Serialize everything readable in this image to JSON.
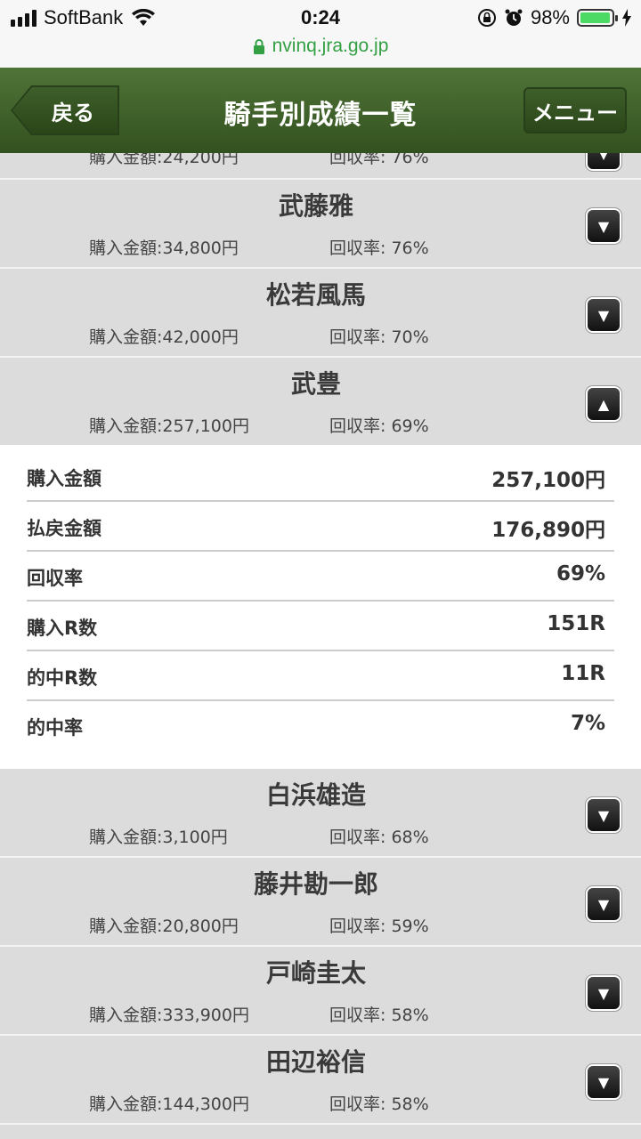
{
  "status_bar": {
    "carrier": "SoftBank",
    "time": "0:24",
    "battery": "98%",
    "battery_level": 0.98
  },
  "url_bar": {
    "url": "nvinq.jra.go.jp"
  },
  "header": {
    "back_label": "戻る",
    "title": "騎手別成績一覧",
    "menu_label": "メニュー"
  },
  "rows_before": [
    {
      "name": "",
      "buy": "購入金額:24,200円",
      "rate": "回収率: 76%",
      "partial": true
    },
    {
      "name": "武藤雅",
      "buy": "購入金額:34,800円",
      "rate": "回収率: 76%"
    },
    {
      "name": "松若風馬",
      "buy": "購入金額:42,000円",
      "rate": "回収率: 70%"
    }
  ],
  "expanded_row": {
    "name": "武豊",
    "buy": "購入金額:257,100円",
    "rate": "回収率: 69%",
    "details": [
      {
        "label": "購入金額",
        "value": "257,100円"
      },
      {
        "label": "払戻金額",
        "value": "176,890円"
      },
      {
        "label": "回収率",
        "value": "69%"
      },
      {
        "label": "購入R数",
        "value": "151R"
      },
      {
        "label": "的中R数",
        "value": "11R"
      },
      {
        "label": "的中率",
        "value": "7%"
      }
    ]
  },
  "rows_after": [
    {
      "name": "白浜雄造",
      "buy": "購入金額:3,100円",
      "rate": "回収率: 68%"
    },
    {
      "name": "藤井勘一郎",
      "buy": "購入金額:20,800円",
      "rate": "回収率: 59%"
    },
    {
      "name": "戸崎圭太",
      "buy": "購入金額:333,900円",
      "rate": "回収率: 58%"
    },
    {
      "name": "田辺裕信",
      "buy": "購入金額:144,300円",
      "rate": "回収率: 58%"
    }
  ],
  "colors": {
    "header_green": "#3f6229",
    "url_green": "#33a044",
    "row_bg": "#dcdcdc"
  },
  "icons": {
    "expand": "chevron-down-icon",
    "collapse": "chevron-up-icon"
  }
}
